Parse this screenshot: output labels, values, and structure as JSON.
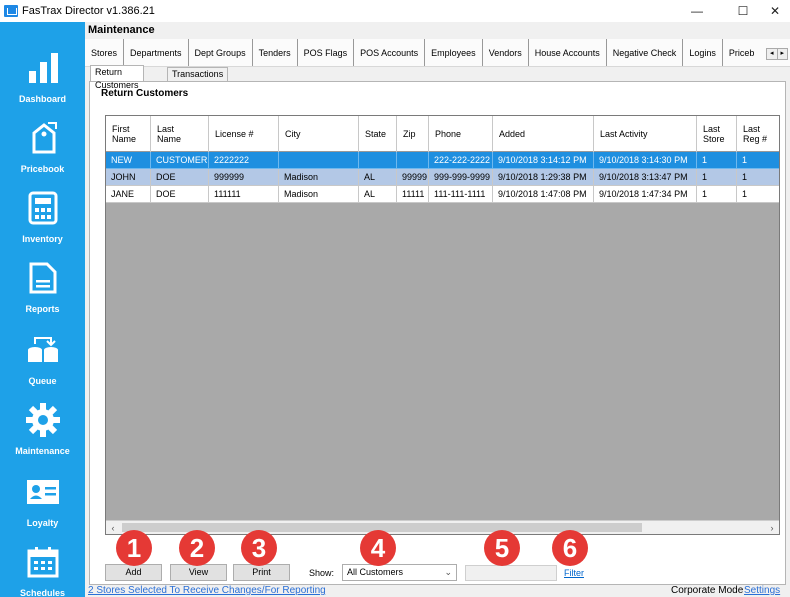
{
  "window": {
    "title": "FasTrax Director v1.386.21",
    "minimize": "—",
    "maximize": "☐",
    "close": "✕"
  },
  "sidebar": {
    "items": [
      {
        "label": "Dashboard"
      },
      {
        "label": "Pricebook"
      },
      {
        "label": "Inventory"
      },
      {
        "label": "Reports"
      },
      {
        "label": "Queue"
      },
      {
        "label": "Maintenance"
      },
      {
        "label": "Loyalty"
      },
      {
        "label": "Schedules"
      }
    ]
  },
  "header": {
    "title": "Maintenance"
  },
  "top_tabs": [
    "Stores",
    "Departments",
    "Dept Groups",
    "Tenders",
    "POS Flags",
    "POS Accounts",
    "Employees",
    "Vendors",
    "House Accounts",
    "Negative Check",
    "Logins",
    "Priceb"
  ],
  "sub_tabs": [
    "Return Customers",
    "Transactions"
  ],
  "panel": {
    "title": "Return Customers"
  },
  "table": {
    "columns": [
      "First\nName",
      "Last\nName",
      "License #",
      "City",
      "State",
      "Zip",
      "Phone",
      "Added",
      "Last Activity",
      "Last\nStore",
      "Last\nReg #"
    ],
    "rows": [
      [
        "NEW",
        "CUSTOMER",
        "2222222",
        "",
        "",
        "",
        "222-222-2222",
        "9/10/2018 3:14:12 PM",
        "9/10/2018 3:14:30 PM",
        "1",
        "1"
      ],
      [
        "JOHN",
        "DOE",
        "999999",
        "Madison",
        "AL",
        "99999",
        "999-999-9999",
        "9/10/2018 1:29:38 PM",
        "9/10/2018 3:13:47 PM",
        "1",
        "1"
      ],
      [
        "JANE",
        "DOE",
        "111111",
        "Madison",
        "AL",
        "11111",
        "111-111-1111",
        "9/10/2018 1:47:08 PM",
        "9/10/2018 1:47:34 PM",
        "1",
        "1"
      ]
    ]
  },
  "controls": {
    "add": "Add",
    "view": "View",
    "print": "Print",
    "show_label": "Show:",
    "show_value": "All Customers",
    "filter_value": "",
    "filter_link": "Filter"
  },
  "badges": [
    "1",
    "2",
    "3",
    "4",
    "5",
    "6"
  ],
  "status": {
    "left": "2 Stores Selected To Receive Changes/For Reporting",
    "mode": "Corporate Mode",
    "settings": "Settings"
  },
  "colors": {
    "sidebar": "#1ea1e8",
    "selected_row": "#1e8fe0",
    "alt_row": "#b3c8e6",
    "badge": "#e53935"
  }
}
